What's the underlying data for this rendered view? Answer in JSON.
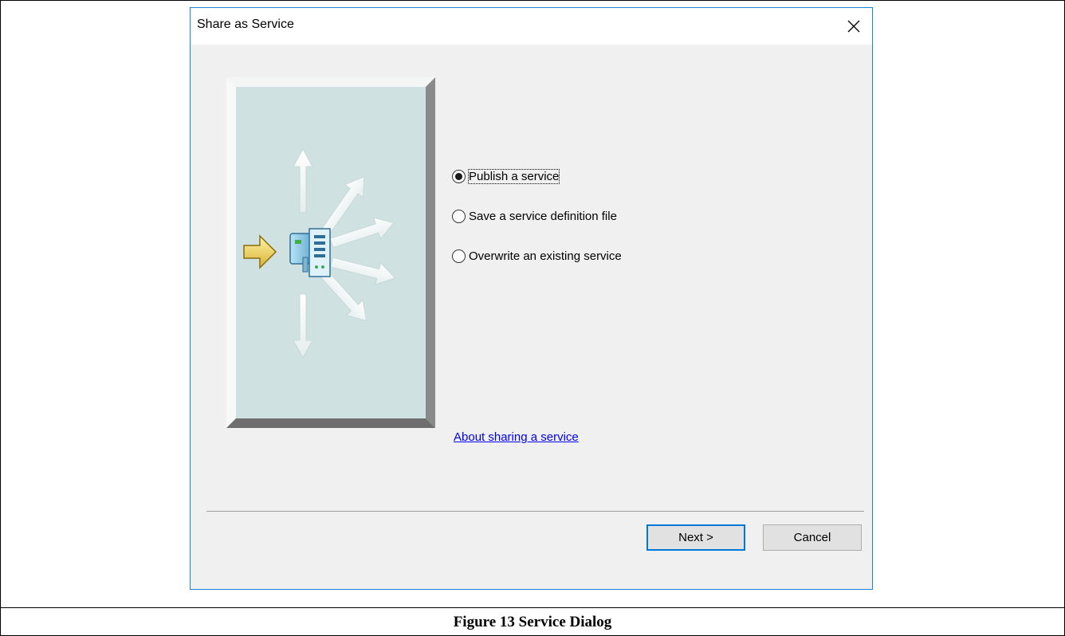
{
  "dialog": {
    "title": "Share as Service",
    "close_icon": "close-icon",
    "image_icon": "publish-service-wizard-graphic"
  },
  "options": [
    {
      "label": "Publish a service",
      "selected": true,
      "focused": true
    },
    {
      "label": "Save a service definition file",
      "selected": false,
      "focused": false
    },
    {
      "label": "Overwrite an existing service",
      "selected": false,
      "focused": false
    }
  ],
  "help_link": "About sharing a service",
  "buttons": {
    "next_label": "Next >",
    "cancel_label": "Cancel"
  },
  "caption": "Figure 13 Service Dialog",
  "colors": {
    "accent": "#0078d7",
    "dialog_border": "#1883d7",
    "dialog_background": "#f0f0f0",
    "link": "#0000ee"
  }
}
